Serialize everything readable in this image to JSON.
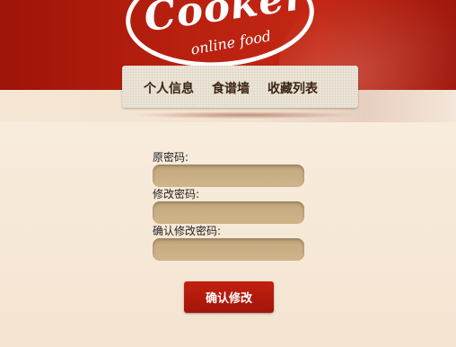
{
  "logo": {
    "title": "Cooker",
    "subtitle": "online food"
  },
  "nav": {
    "items": [
      {
        "label": "个人信息"
      },
      {
        "label": "食谱墙"
      },
      {
        "label": "收藏列表"
      }
    ]
  },
  "form": {
    "old_password_label": "原密码:",
    "new_password_label": "修改密码:",
    "confirm_password_label": "确认修改密码:",
    "old_password_value": "",
    "new_password_value": "",
    "confirm_password_value": "",
    "submit_label": "确认修改"
  },
  "colors": {
    "banner": "#b01c0d",
    "button": "#b41a0c",
    "input": "#c9ad84"
  }
}
